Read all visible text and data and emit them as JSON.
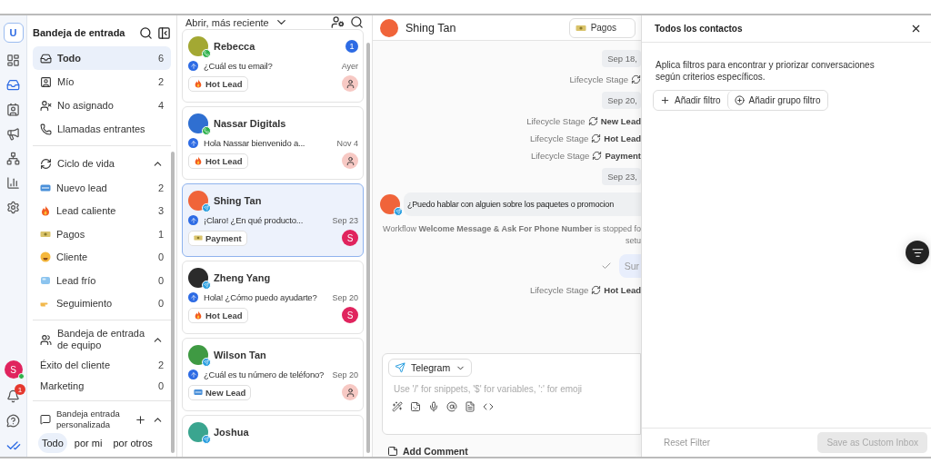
{
  "rail": {
    "logo": "U",
    "items": [
      {
        "selected": false
      },
      {
        "selected": true
      },
      {
        "selected": false
      },
      {
        "selected": false
      },
      {
        "selected": false
      },
      {
        "selected": false
      },
      {
        "selected": false
      }
    ],
    "user_initial": "S",
    "online": true,
    "notifications": "1"
  },
  "sidebar": {
    "title": "Bandeja de entrada",
    "items": [
      {
        "label": "Todo",
        "count": "6",
        "selected": true
      },
      {
        "label": "Mío",
        "count": "2",
        "selected": false
      },
      {
        "label": "No asignado",
        "count": "4",
        "selected": false
      },
      {
        "label": "Llamadas entrantes",
        "selected": false
      }
    ],
    "lifecycle": {
      "title": "Ciclo de vida",
      "expanded": true,
      "items": [
        {
          "kind": "new",
          "label": "Nuevo lead",
          "count": "2"
        },
        {
          "kind": "fire",
          "label": "Lead caliente",
          "count": "3"
        },
        {
          "kind": "cash",
          "label": "Pagos",
          "count": "1"
        },
        {
          "kind": "smile",
          "label": "Cliente",
          "count": "0"
        },
        {
          "kind": "ice",
          "label": "Lead frío",
          "count": "0"
        },
        {
          "kind": "hand",
          "label": "Seguimiento",
          "count": "0"
        }
      ]
    },
    "team": {
      "title": "Bandeja de entrada de equipo",
      "expanded": true,
      "items": [
        {
          "label": "Éxito del cliente",
          "count": "2"
        },
        {
          "label": "Marketing",
          "count": "0"
        }
      ]
    },
    "custom": {
      "title": "Bandeja entrada personalizada",
      "expanded": true,
      "tabs": [
        {
          "label": "Todo",
          "selected": true
        },
        {
          "label": "por mi",
          "selected": false
        },
        {
          "label": "por otros",
          "selected": false
        }
      ]
    }
  },
  "list": {
    "sort": "Abrir, más reciente",
    "conversations": [
      {
        "name": "Rebecca",
        "kind": "whatsapp",
        "color": "#a3a833",
        "unread": "1",
        "preview": "¿Cuál es tu email?",
        "time": "Ayer",
        "tag": {
          "kind": "fire",
          "label": "Hot Lead"
        },
        "assignee": {
          "kind": "agent"
        },
        "selected": false
      },
      {
        "name": "Nassar Digitals",
        "kind": "whatsapp",
        "color": "#2f6fd1",
        "preview": "Hola Nassar bienvenido a...",
        "time": "Nov 4",
        "tag": {
          "kind": "fire",
          "label": "Hot Lead"
        },
        "assignee": {
          "kind": "agent"
        },
        "selected": false
      },
      {
        "name": "Shing Tan",
        "kind": "telegram",
        "color": "#f0643a",
        "preview": "¡Claro! ¿En qué producto...",
        "time": "Sep 23",
        "tag": {
          "kind": "cash",
          "label": "Payment"
        },
        "assignee": {
          "kind": "user",
          "initial": "S"
        },
        "selected": true
      },
      {
        "name": "Zheng Yang",
        "kind": "telegram",
        "color": "#2b2b2b",
        "preview": "Hola! ¿Cómo puedo ayudarte?",
        "time": "Sep 20",
        "tag": {
          "kind": "fire",
          "label": "Hot Lead"
        },
        "assignee": {
          "kind": "user",
          "initial": "S"
        },
        "selected": false
      },
      {
        "name": "Wilson Tan",
        "kind": "telegram",
        "color": "#3f9a43",
        "preview": "¿Cuál es tu número de teléfono?",
        "time": "Sep 20",
        "tag": {
          "kind": "new",
          "label": "New Lead"
        },
        "assignee": {
          "kind": "agent"
        },
        "selected": false
      },
      {
        "name": "Joshua",
        "kind": "telegram",
        "color": "#3aa58f",
        "selected": false
      }
    ]
  },
  "chat": {
    "name": "Shing Tan",
    "stage": {
      "kind": "cash",
      "label": "Pagos"
    },
    "timeline": [
      {
        "kind": "date",
        "text": "Sep 18,"
      },
      {
        "kind": "stage",
        "label": "Lifecycle Stage"
      },
      {
        "kind": "date",
        "text": "Sep 20,"
      },
      {
        "kind": "stage",
        "label": "Lifecycle Stage",
        "value": "New Lead"
      },
      {
        "kind": "stage",
        "label": "Lifecycle Stage",
        "value": "Hot Lead"
      },
      {
        "kind": "stage",
        "label": "Lifecycle Stage",
        "value": "Payment"
      },
      {
        "kind": "date",
        "text": "Sep 23,"
      },
      {
        "kind": "incoming",
        "text": "¿Puedo hablar con alguien sobre los paquetes o promocion"
      },
      {
        "kind": "system",
        "lines": [
          "Workflow **Welcome Message & Ask For Phone Number** is stopped fo",
          "setu"
        ]
      },
      {
        "kind": "outgoing",
        "text": "Sur"
      },
      {
        "kind": "stage",
        "label": "Lifecycle Stage",
        "value": "Hot Lead"
      }
    ],
    "composer": {
      "channel": "Telegram",
      "placeholder": "Use '/' for snippets, '$' for variables, ':' for emoji"
    },
    "comment": "Add Comment"
  },
  "filter": {
    "title": "Todos los contactos",
    "description": "Aplica filtros para encontrar y priorizar conversaciones según criterios específicos.",
    "add_filter": "Añadir filtro",
    "add_group": "Añadir grupo filtro",
    "reset": "Reset Filter",
    "save": {
      "label": "Save as Custom Inbox",
      "disabled": true
    }
  }
}
